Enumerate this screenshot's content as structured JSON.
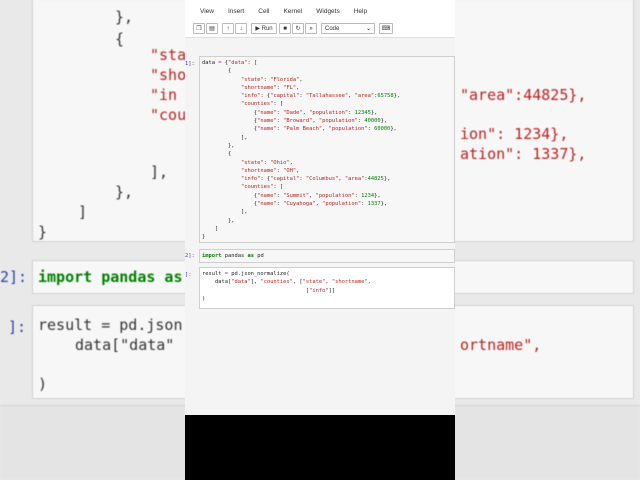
{
  "menu": [
    "View",
    "Insert",
    "Cell",
    "Kernel",
    "Widgets",
    "Help"
  ],
  "toolbar": {
    "run_label": "Run",
    "cell_type": "Code"
  },
  "cells": {
    "c1": {
      "prompt": "1]:",
      "lines": [
        "data = {\"data\": [",
        "        {",
        "            \"state\": \"Florida\",",
        "            \"shortname\": \"FL\",",
        "            \"info\": {\"capital\": \"Tallahassee\", \"area\":65758},",
        "            \"counties\": [",
        "                {\"name\": \"Dade\", \"population\": 12345},",
        "                {\"name\": \"Broward\", \"population\": 40000},",
        "                {\"name\": \"Palm Beach\", \"population\": 60000},",
        "            ],",
        "        },",
        "        {",
        "            \"state\": \"Ohio\",",
        "            \"shortname\": \"OH\",",
        "            \"info\": {\"capital\": \"Columbus\", \"area\":44825},",
        "            \"counties\": [",
        "                {\"name\": \"Summit\", \"population\": 1234},",
        "                {\"name\": \"Cuyahoga\", \"population\": 1337},",
        "            ],",
        "        },",
        "    ]",
        "}"
      ]
    },
    "c2": {
      "prompt": "2]:",
      "text": "import pandas as pd"
    },
    "c3": {
      "prompt": "]:",
      "lines": [
        "result = pd.json_normalize(",
        "    data[\"data\"], \"counties\", [\"state\", \"shortname\",",
        "                                [\"info\"]]",
        ")"
      ]
    }
  },
  "background": {
    "top_lines": [
      "},",
      "{",
      "\"sta",
      "\"sho",
      "\"in",
      "\"cou",
      "],",
      "},",
      "]",
      "}"
    ],
    "right_lines": [
      "\"area\":44825},",
      "ion\": 1234},",
      "ation\": 1337},"
    ],
    "import_prompt": "2]:",
    "import_text": "import pandas as",
    "result_prompt": "]:",
    "result_line1": "result = pd.json",
    "result_line2": "data[\"data\"",
    "result_right": "ortname\",",
    "result_close": ")"
  }
}
